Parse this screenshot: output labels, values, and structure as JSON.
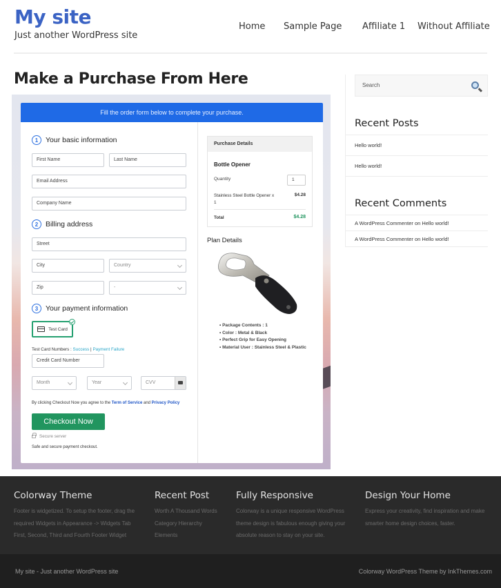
{
  "header": {
    "site_title": "My site",
    "tagline": "Just another WordPress site",
    "nav": [
      "Home",
      "Sample Page",
      "Affiliate 1",
      "Without Affiliate"
    ]
  },
  "main": {
    "page_title": "Make a Purchase From Here",
    "form": {
      "banner": "Fill the order form below to complete your purchase.",
      "sections": {
        "basic": {
          "number": "1",
          "title": "Your basic information"
        },
        "billing": {
          "number": "2",
          "title": "Billing address"
        },
        "payment": {
          "number": "3",
          "title": "Your payment information"
        }
      },
      "fields": {
        "first_name": "First Name",
        "last_name": "Last Name",
        "email": "Email Address",
        "company": "Company Name",
        "street": "Street",
        "city": "City",
        "country": "Country",
        "zip": "Zip",
        "state": "-",
        "card_number": "Credit Card Number",
        "month": "Month",
        "year": "Year",
        "cvv": "CVV"
      },
      "payment_method": "Test Card",
      "test_numbers_label": "Test Card Numbers : ",
      "test_success": "Success",
      "test_sep": " | ",
      "test_failure": "Payment Failure",
      "agree_prefix": "By clicking Checkout Now you agree to the ",
      "terms_link": "Term of Service",
      "agree_and": " and ",
      "privacy_link": "Privacy Policy",
      "checkout_button": "Checkout Now",
      "secure_server": "Secure server",
      "safe_text": "Safe and secure payment checkout."
    },
    "purchase": {
      "header": "Purchase Details",
      "product": "Bottle Opener",
      "quantity_label": "Quantity",
      "quantity": "1",
      "item": "Stainless Steel Bottle Opener x 1",
      "item_price": "$4.28",
      "total_label": "Total",
      "total": "$4.28"
    },
    "plan": {
      "title": "Plan Details",
      "features": [
        "Package Contents : 1",
        "Color : Metal & Black",
        "Perfect Grip for Easy Opening",
        "Material User : Stainless Steel & Plastic"
      ]
    }
  },
  "sidebar": {
    "search_placeholder": "Search",
    "recent_posts_title": "Recent Posts",
    "recent_posts": [
      "Hello world!",
      "Hello world!"
    ],
    "recent_comments_title": "Recent Comments",
    "recent_comments": [
      "A WordPress Commenter on Hello world!",
      "A WordPress Commenter on Hello world!"
    ]
  },
  "footer": {
    "cols": [
      {
        "title": "Colorway Theme",
        "lines": [
          "Footer is widgetized. To setup the footer, drag the",
          "required Widgets in Appearance -> Widgets Tab",
          "First, Second, Third and Fourth Footer Widget"
        ]
      },
      {
        "title": "Recent Post",
        "lines": [
          "Worth A Thousand Words",
          "Category Hierarchy",
          "Elements"
        ]
      },
      {
        "title": "Fully Responsive",
        "lines": [
          "Colorway is a unique responsive WordPress",
          "theme design is fabulous enough giving your",
          "absolute reason to stay on your site."
        ]
      },
      {
        "title": "Design Your Home",
        "lines": [
          "Express your creativity, find inspiration and make",
          "smarter home design choices, faster."
        ]
      }
    ],
    "bottom_left": "My site - Just another WordPress site",
    "bottom_right": "Colorway WordPress Theme by InkThemes.com"
  },
  "colors": {
    "brand": "#3b63c4",
    "banner": "#1f6ae6",
    "checkout": "#21955f",
    "footer_bg": "#2a2a2a"
  }
}
